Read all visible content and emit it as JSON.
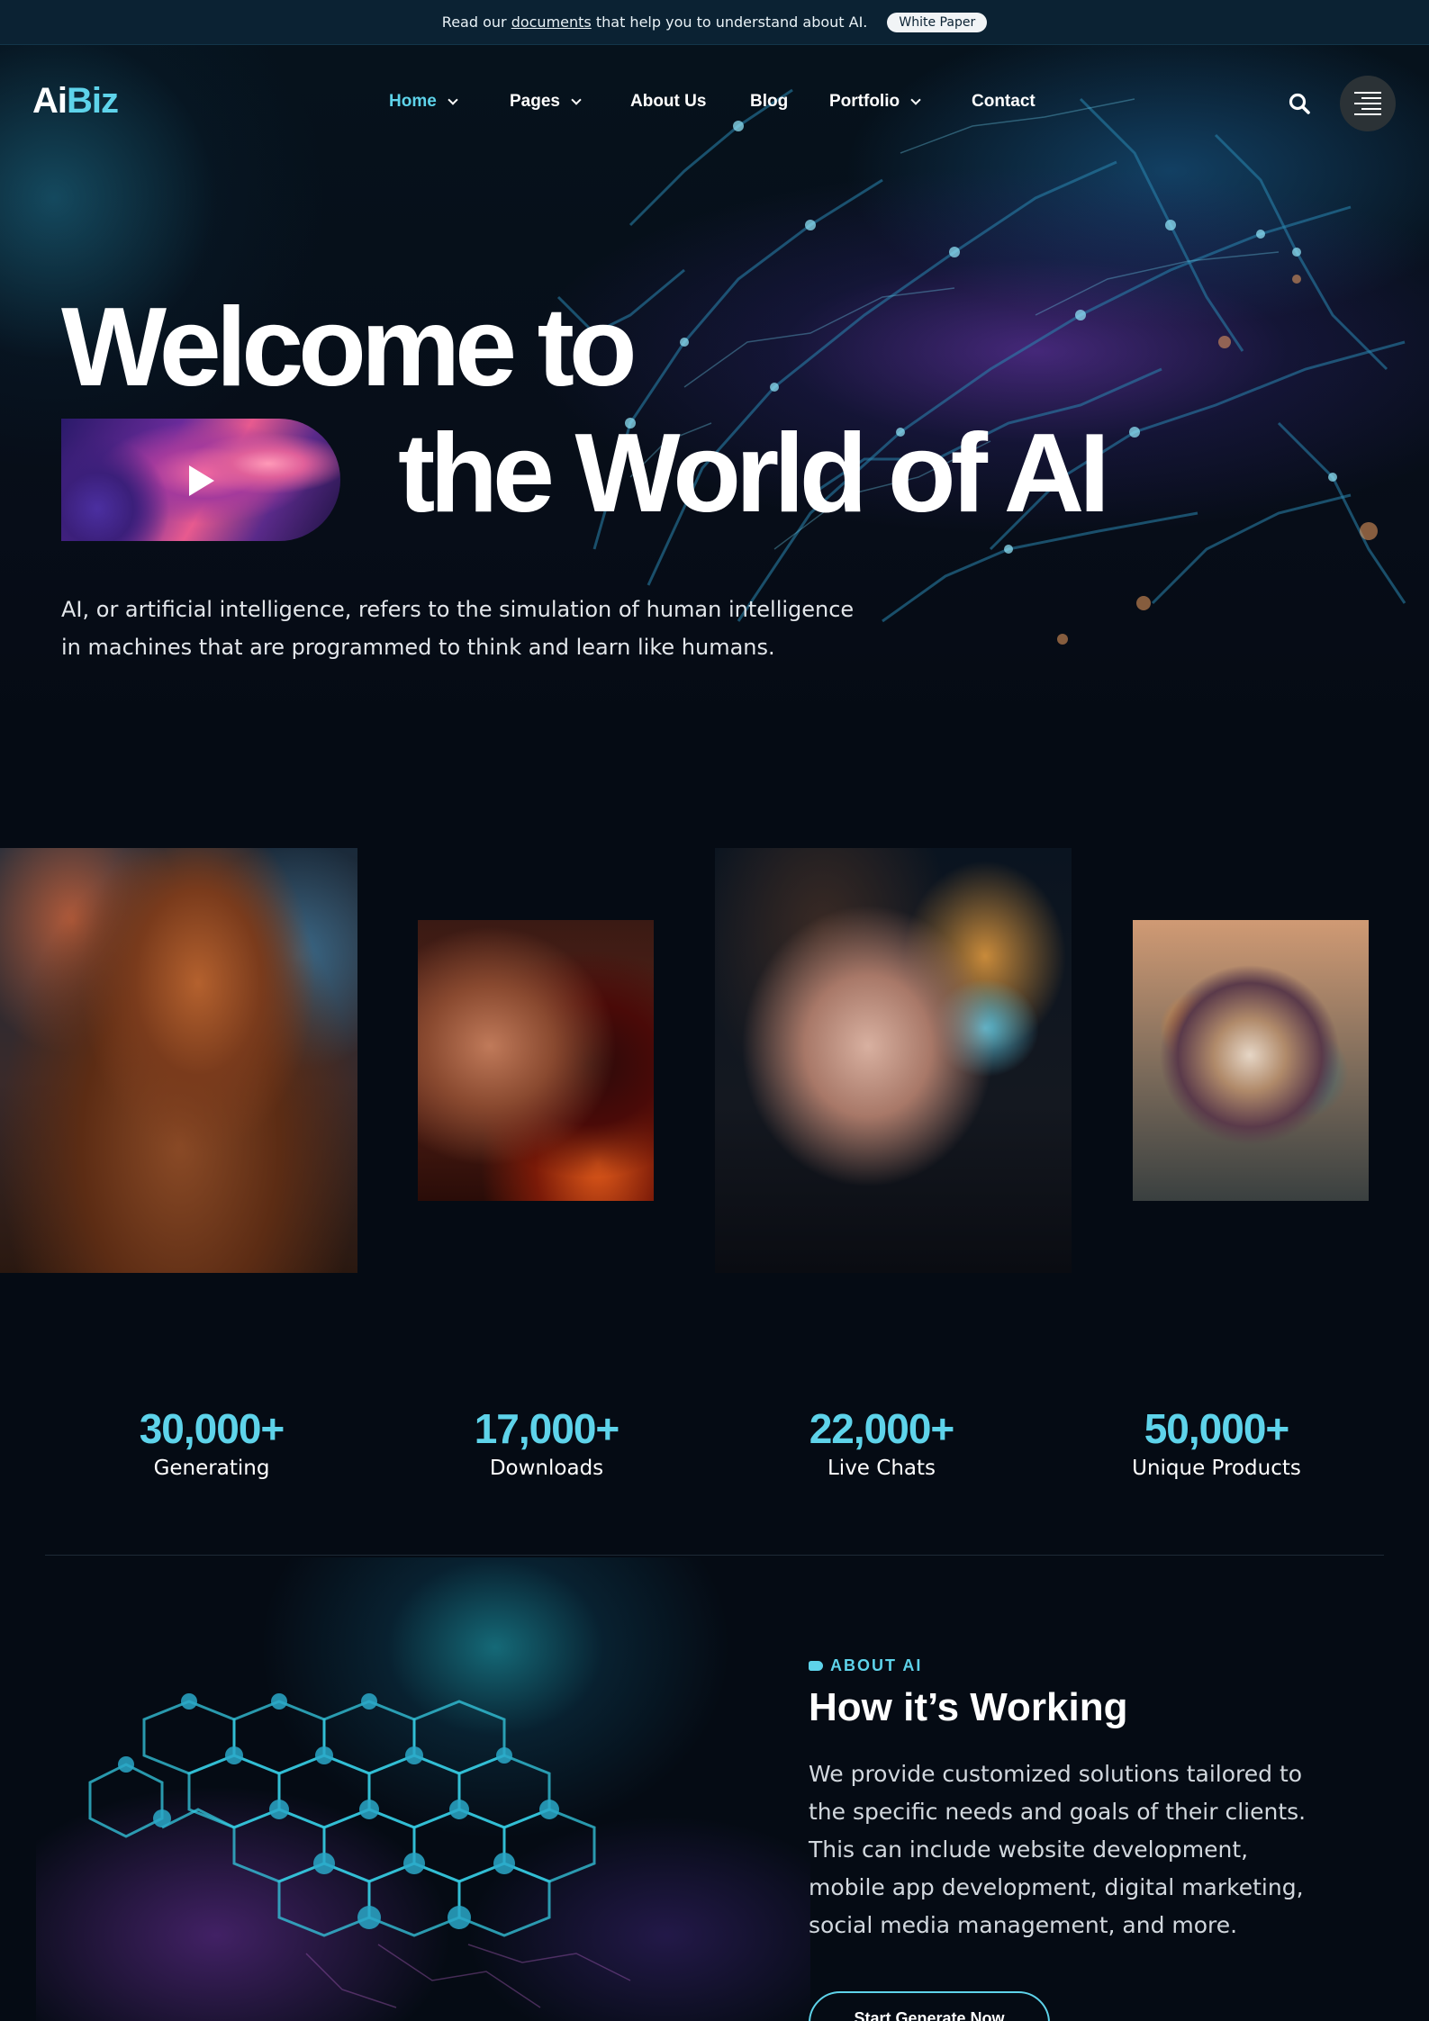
{
  "announcement": {
    "prefix": "Read our",
    "link": "documents",
    "suffix": "that help you to understand about AI.",
    "button": "White Paper"
  },
  "brand": {
    "part1": "Ai",
    "part2": "Biz",
    "accent_color": "#5ed3ea"
  },
  "nav": {
    "items": [
      {
        "label": "Home",
        "active": true,
        "dropdown": true
      },
      {
        "label": "Pages",
        "active": false,
        "dropdown": true
      },
      {
        "label": "About Us",
        "active": false,
        "dropdown": false
      },
      {
        "label": "Blog",
        "active": false,
        "dropdown": false
      },
      {
        "label": "Portfolio",
        "active": false,
        "dropdown": true
      },
      {
        "label": "Contact",
        "active": false,
        "dropdown": false
      }
    ],
    "icons": [
      "search-icon",
      "menu-icon"
    ]
  },
  "hero": {
    "title_line1": "Welcome to",
    "title_line2": "the World of AI",
    "description": "AI, or artificial intelligence, refers to the simulation of human intelligence in machines that are programmed to think and learn like humans."
  },
  "gallery": [
    "lion",
    "woman-fire",
    "woman-butterfly",
    "organic-sphere"
  ],
  "stats": [
    {
      "value": "30,000+",
      "label": "Generating"
    },
    {
      "value": "17,000+",
      "label": "Downloads"
    },
    {
      "value": "22,000+",
      "label": "Live Chats"
    },
    {
      "value": "50,000+",
      "label": "Unique Products"
    }
  ],
  "about": {
    "tag": "ABOUT AI",
    "title": "How it’s Working",
    "description": "We provide customized solutions tailored to the specific needs and goals of their clients. This can include website development, mobile app development, digital marketing, social media management, and more.",
    "cta": "Start Generate Now"
  }
}
